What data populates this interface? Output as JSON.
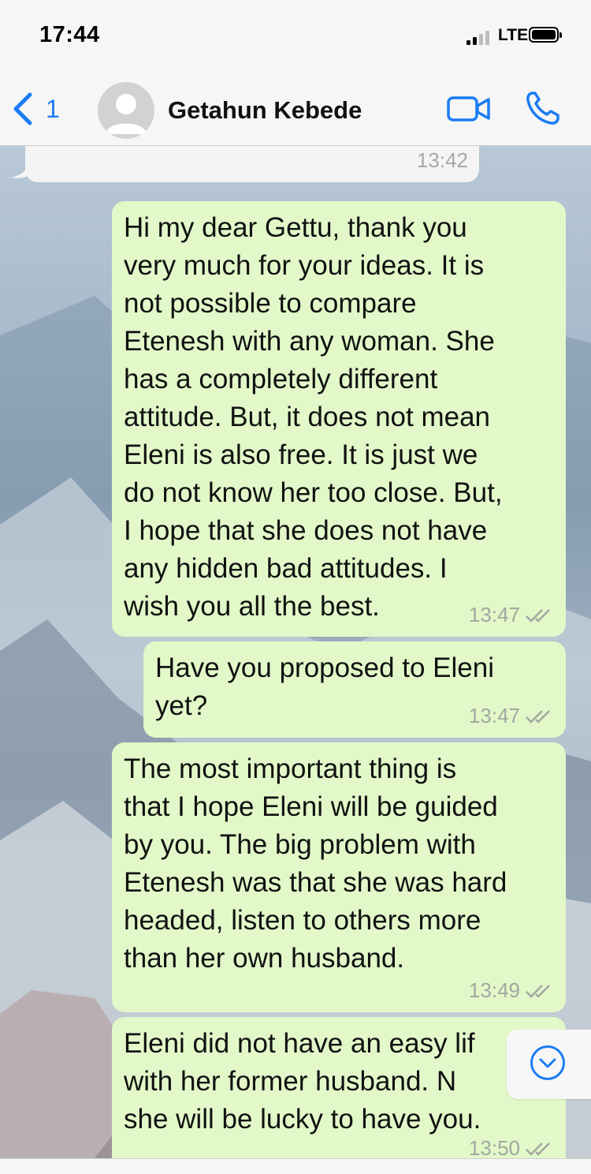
{
  "status_bar": {
    "time": "17:44",
    "network": "LTE"
  },
  "header": {
    "back_count": "1",
    "contact_name": "Getahun Kebede",
    "icons": [
      "chevron-left-icon",
      "avatar-placeholder-icon",
      "video-camera-icon",
      "phone-icon"
    ],
    "accent_color": "#1a7cf5"
  },
  "messages": [
    {
      "direction": "incoming",
      "text": "",
      "time": "13:42"
    },
    {
      "direction": "outgoing",
      "text": "Hi my dear Gettu, thank you\nvery much for your ideas. It is\nnot possible to compare\nEtenesh with any woman. She\nhas a completely different\nattitude. But, it does not mean\nEleni is also free. It is just we\ndo not know her too close. But,\nI hope that she does not have\nany hidden bad attitudes. I\nwish you all the best.",
      "time": "13:47",
      "status": "read"
    },
    {
      "direction": "outgoing",
      "text": "Have you proposed to Eleni\nyet?",
      "time": "13:47",
      "status": "read"
    },
    {
      "direction": "outgoing",
      "text": "The most important thing is\nthat I hope Eleni will be guided\nby you. The big problem with\nEtenesh was that she was hard\nheaded, listen to others more\nthan her own husband.",
      "time": "13:49",
      "status": "read"
    },
    {
      "direction": "outgoing",
      "text": "Eleni did not have an easy lif\nwith her former husband. N\nshe will be lucky to have you.",
      "time": "13:50",
      "status": "read"
    }
  ],
  "colors": {
    "outgoing_bubble": "#e2f8c9",
    "incoming_bubble": "#f4f4f4"
  }
}
